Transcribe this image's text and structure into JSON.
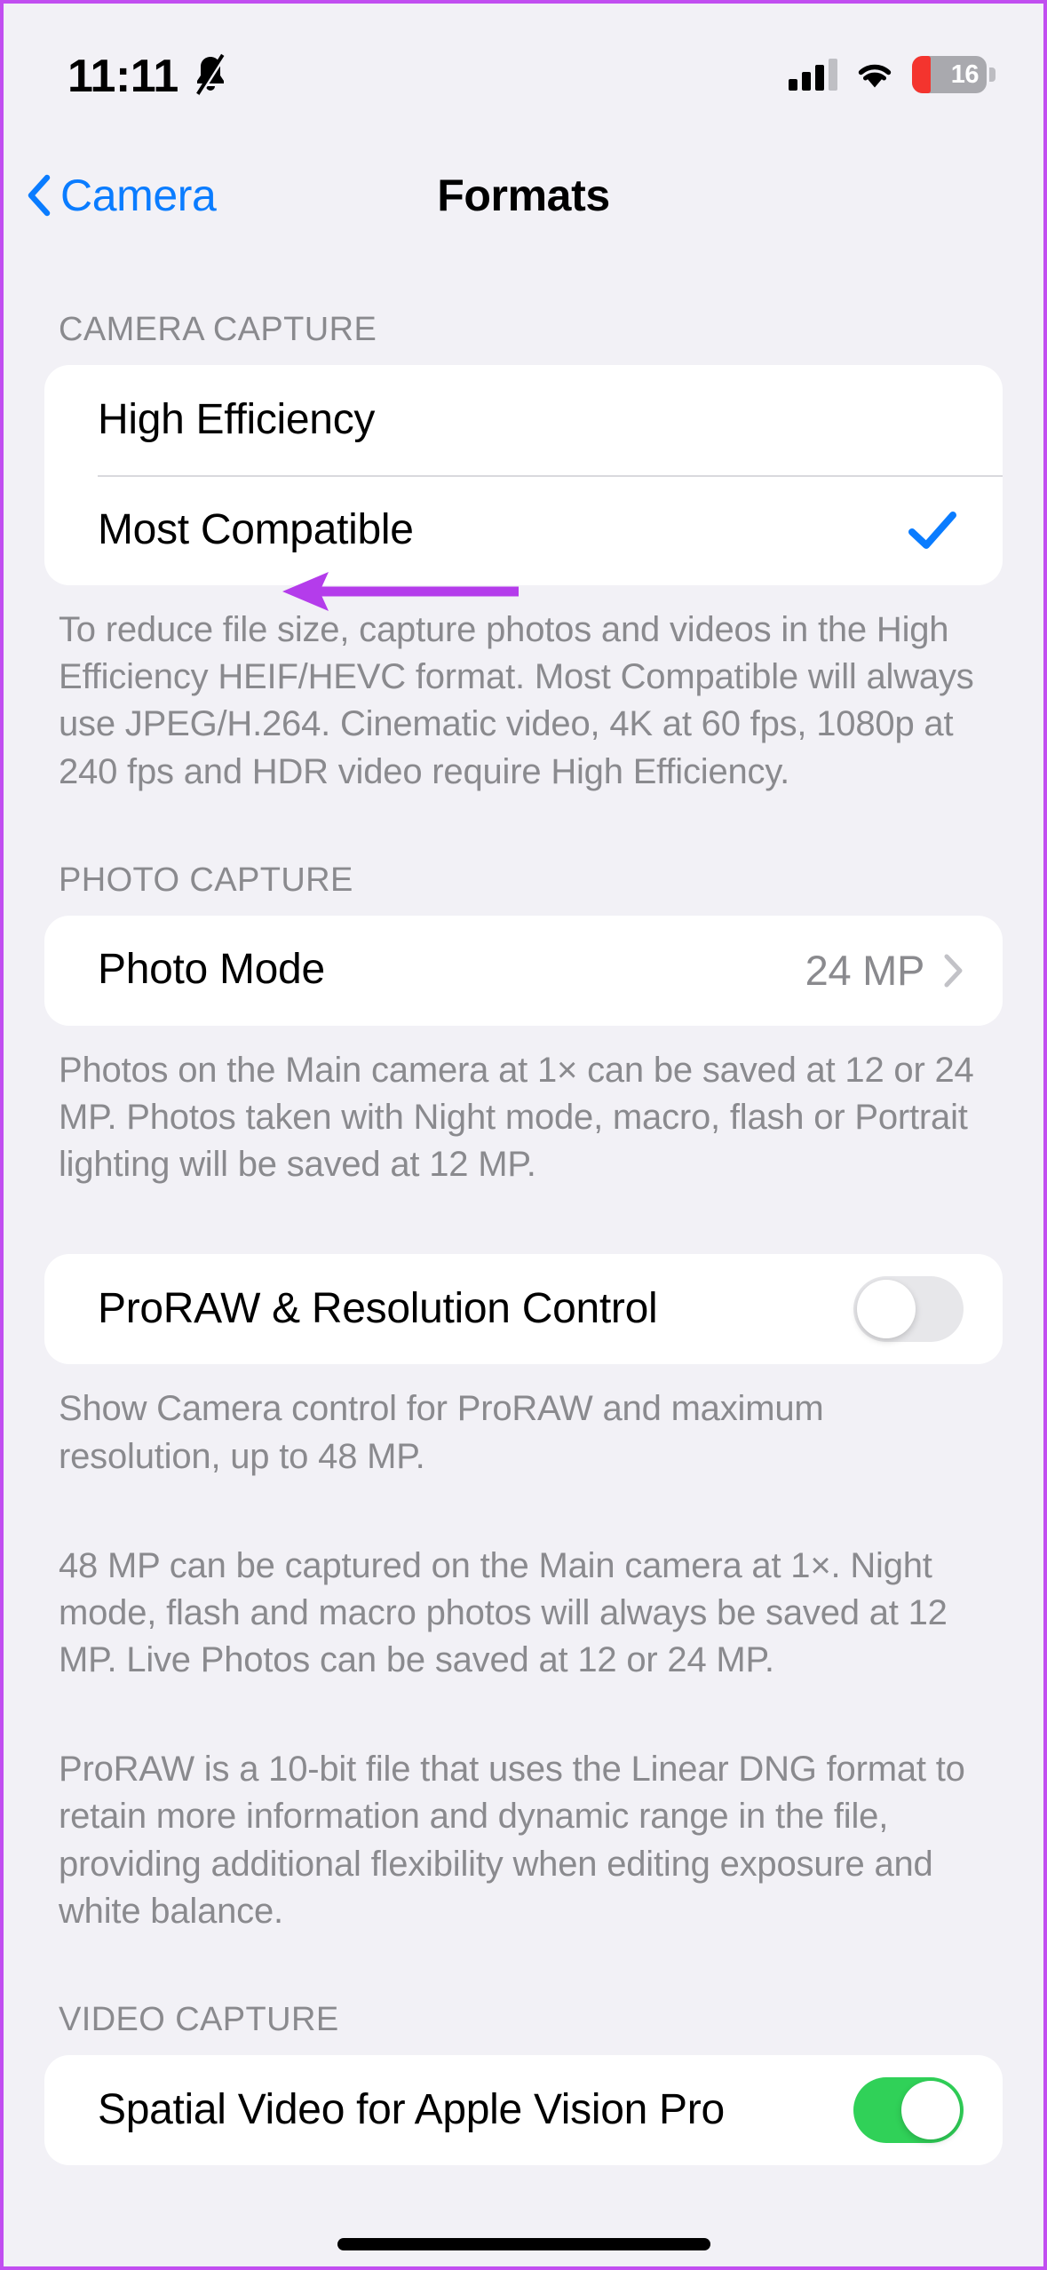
{
  "status_bar": {
    "time": "11:11",
    "mute_icon": "bell-slash-icon",
    "signal_icon": "cellular-signal-icon",
    "wifi_icon": "wifi-icon",
    "battery_percent": "16",
    "battery_fill_color": "#f4342e",
    "battery_body_color": "#a9a9ae"
  },
  "nav": {
    "back_label": "Camera",
    "back_icon": "chevron-left-icon",
    "title": "Formats",
    "accent_color": "#0a7cff"
  },
  "sections": {
    "camera_capture": {
      "header": "CAMERA CAPTURE",
      "rows": [
        {
          "label": "High Efficiency",
          "selected": false
        },
        {
          "label": "Most Compatible",
          "selected": true
        }
      ],
      "footer": "To reduce file size, capture photos and videos in the High Efficiency HEIF/HEVC format. Most Compatible will always use JPEG/H.264. Cinematic video, 4K at 60 fps, 1080p at 240 fps and HDR video require High Efficiency."
    },
    "photo_capture": {
      "header": "PHOTO CAPTURE",
      "photo_mode": {
        "label": "Photo Mode",
        "value": "24 MP",
        "chevron_icon": "chevron-right-icon"
      },
      "photo_mode_footer": "Photos on the Main camera at 1× can be saved at 12 or 24 MP. Photos taken with Night mode, macro, flash or Portrait lighting will be saved at 12 MP.",
      "proraw": {
        "label": "ProRAW & Resolution Control",
        "toggle_state": "off"
      },
      "proraw_footer_1": "Show Camera control for ProRAW and maximum resolution, up to 48 MP.",
      "proraw_footer_2": "48 MP can be captured on the Main camera at 1×. Night mode, flash and macro photos will always be saved at 12 MP. Live Photos can be saved at 12 or 24 MP.",
      "proraw_footer_3": "ProRAW is a 10-bit file that uses the Linear DNG format to retain more information and dynamic range in the file, providing additional flexibility when editing exposure and white balance."
    },
    "video_capture": {
      "header": "VIDEO CAPTURE",
      "spatial_video": {
        "label": "Spatial Video for Apple Vision Pro",
        "toggle_state": "on"
      }
    }
  },
  "annotation": {
    "arrow_icon": "left-arrow-annotation",
    "color": "#b43ceb",
    "points_at": "Most Compatible"
  },
  "theme": {
    "page_background": "#f2f1f6",
    "card_background": "#ffffff",
    "secondary_text": "#8a8a8e",
    "toggle_on_color": "#30d158",
    "toggle_off_color": "#e7e7ea",
    "border_color": "#c14ef0"
  }
}
